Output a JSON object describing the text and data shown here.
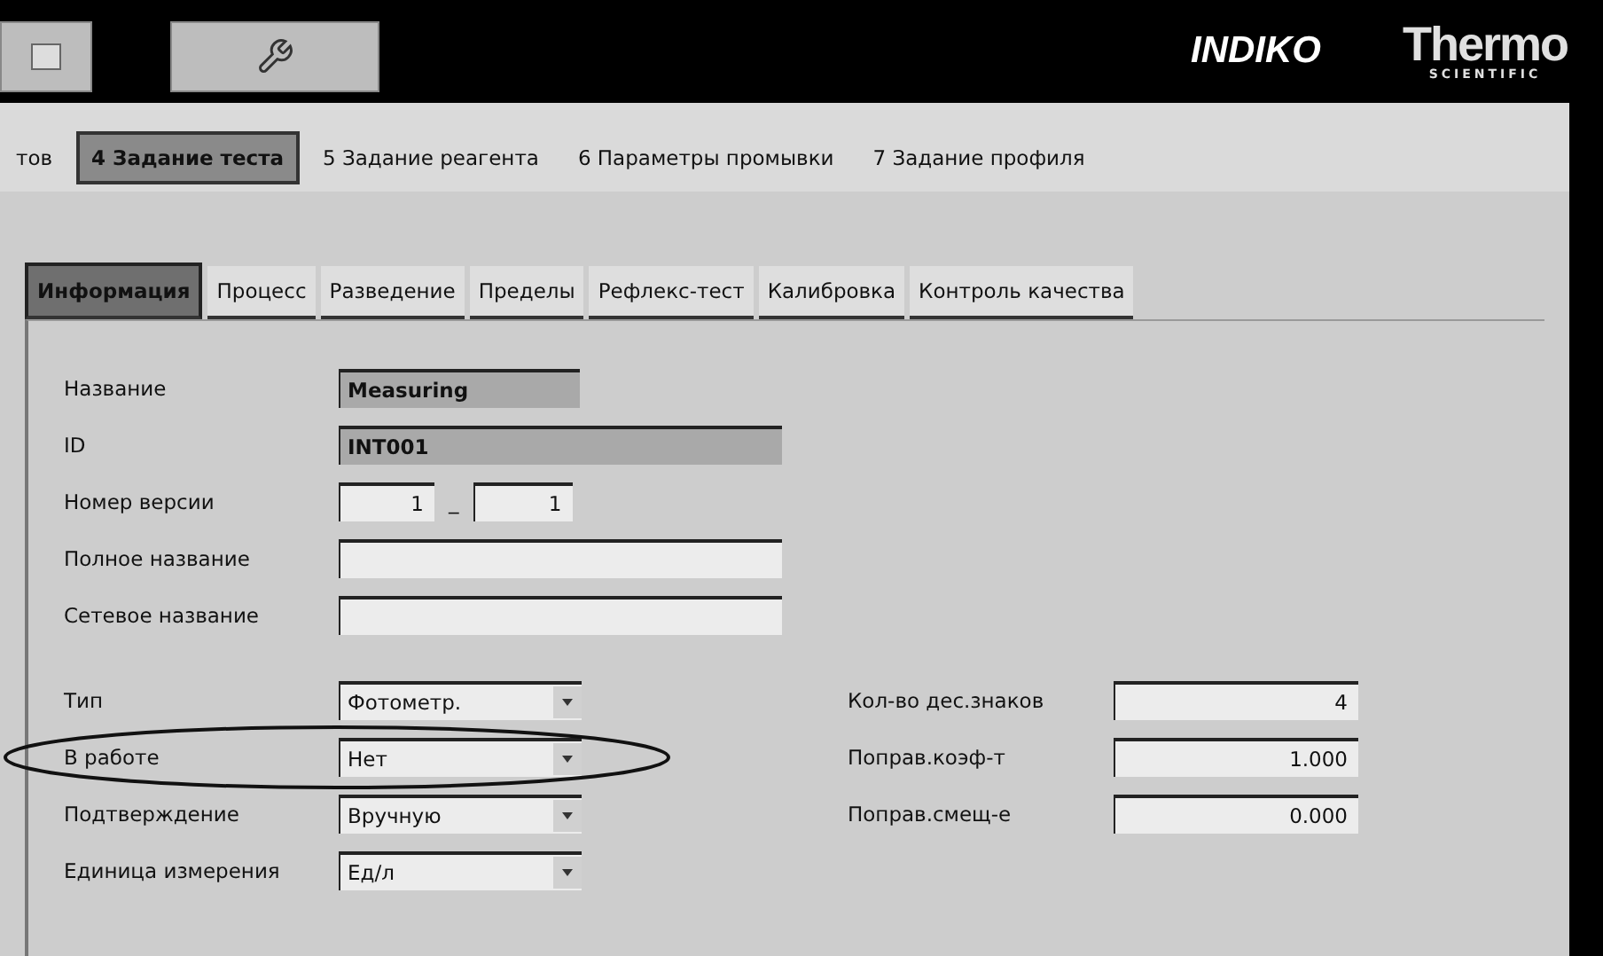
{
  "header": {
    "product": "INDIKO",
    "brand": "Thermo",
    "brand_sub": "SCIENTIFIC"
  },
  "top_tabs": [
    {
      "label": "тов",
      "selected": false
    },
    {
      "label": "4 Задание теста",
      "selected": true
    },
    {
      "label": "5 Задание реагента",
      "selected": false
    },
    {
      "label": "6 Параметры промывки",
      "selected": false
    },
    {
      "label": "7 Задание профиля",
      "selected": false
    }
  ],
  "inner_tabs": [
    {
      "label": "Информация",
      "selected": true
    },
    {
      "label": "Процесс",
      "selected": false
    },
    {
      "label": "Разведение",
      "selected": false
    },
    {
      "label": "Пределы",
      "selected": false
    },
    {
      "label": "Рефлекс-тест",
      "selected": false
    },
    {
      "label": "Калибровка",
      "selected": false
    },
    {
      "label": "Контроль качества",
      "selected": false
    }
  ],
  "upper_fields": [
    {
      "kind": "readonly",
      "label": "Название",
      "value": "Measuring",
      "wide": false
    },
    {
      "kind": "readonly",
      "label": "ID",
      "value": "INT001",
      "wide": true
    },
    {
      "kind": "version",
      "label": "Номер версии",
      "major": "1",
      "separator": "_",
      "minor": "1"
    },
    {
      "kind": "text",
      "label": "Полное название",
      "wide": true
    },
    {
      "kind": "text",
      "label": "Сетевое название",
      "wide": true
    }
  ],
  "left_fields": [
    {
      "label": "Тип",
      "value": "Фотометр."
    },
    {
      "label": "В работе",
      "value": "Нет"
    },
    {
      "label": "Подтверждение",
      "value": "Вручную"
    },
    {
      "label": "Единица измерения",
      "value": "Ед/л"
    }
  ],
  "right_fields": [
    {
      "label": "Кол-во дес.знаков",
      "value": "4"
    },
    {
      "label": "Поправ.коэф-т",
      "value": "1.000"
    },
    {
      "label": "Поправ.смещ-е",
      "value": "0.000"
    }
  ]
}
